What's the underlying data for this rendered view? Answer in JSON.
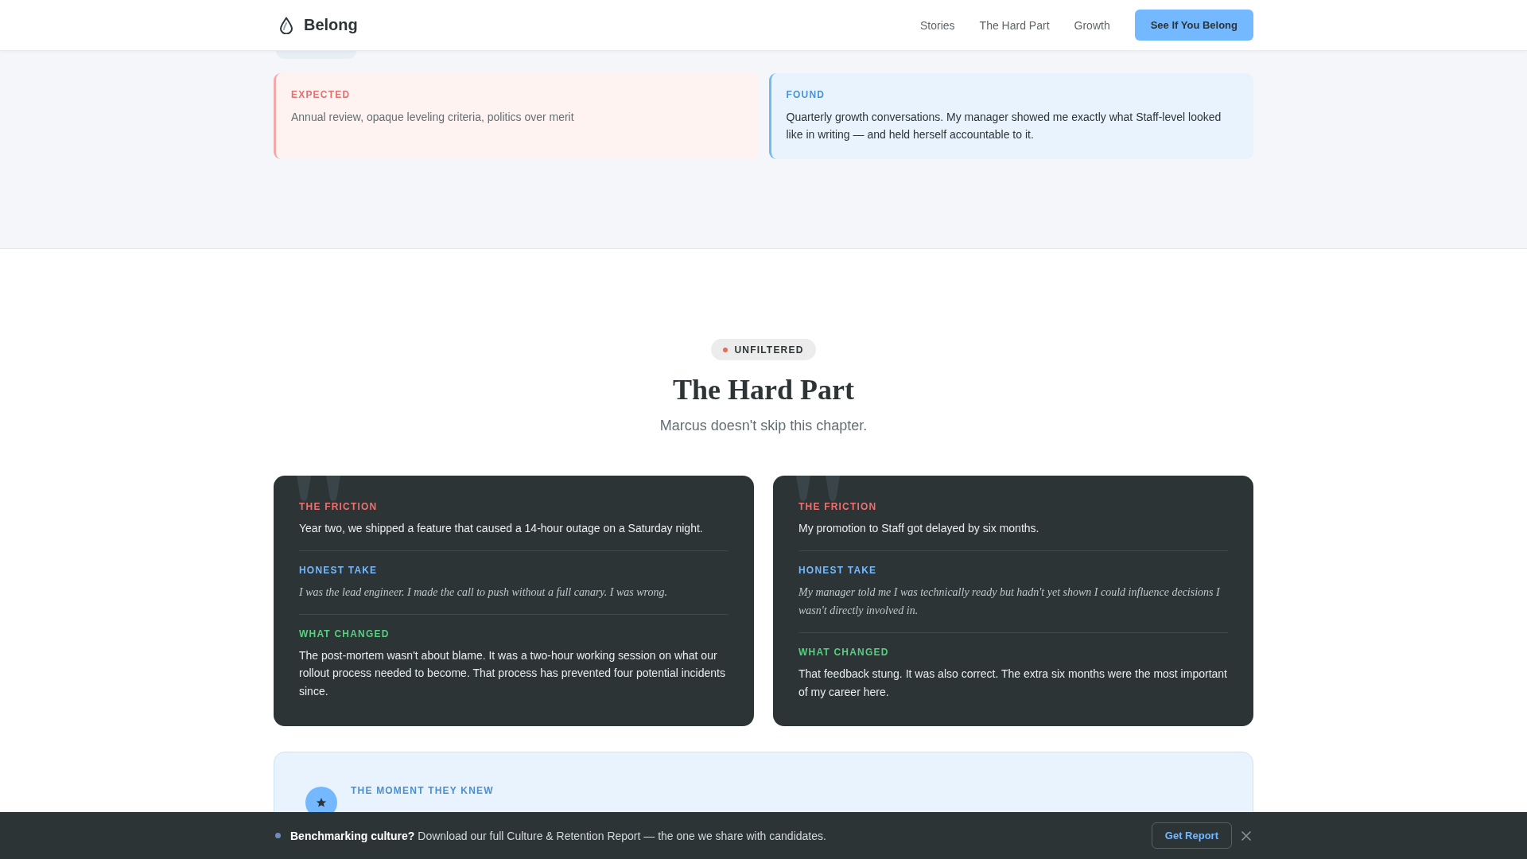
{
  "header": {
    "brand": "Belong",
    "nav": [
      "Stories",
      "The Hard Part",
      "Growth"
    ],
    "cta": "See If You Belong"
  },
  "growth_section": {
    "comparison": [
      {
        "kind": "expected",
        "label": "EXPECTED",
        "text": "Annual review, opaque leveling criteria, politics over merit"
      },
      {
        "kind": "found",
        "label": "FOUND",
        "text": "Quarterly growth conversations. My manager showed me exactly what Staff-level looked like in writing — and held herself accountable to it."
      }
    ]
  },
  "hard_part": {
    "badge": "UNFILTERED",
    "title": "The Hard Part",
    "subtitle": "Marcus doesn't skip this chapter.",
    "stories": [
      {
        "sections": [
          {
            "kind": "friction",
            "label": "THE FRICTION",
            "text": "Year two, we shipped a feature that caused a 14-hour outage on a Saturday night."
          },
          {
            "kind": "honest",
            "label": "HONEST TAKE",
            "text": "I was the lead engineer. I made the call to push without a full canary. I was wrong."
          },
          {
            "kind": "changed",
            "label": "WHAT CHANGED",
            "text": "The post-mortem wasn't about blame. It was a two-hour working session on what our rollout process needed to become. That process has prevented four potential incidents since."
          }
        ]
      },
      {
        "sections": [
          {
            "kind": "friction",
            "label": "THE FRICTION",
            "text": "My promotion to Staff got delayed by six months."
          },
          {
            "kind": "honest",
            "label": "HONEST TAKE",
            "text": "My manager told me I was technically ready but hadn't yet shown I could influence decisions I wasn't directly involved in."
          },
          {
            "kind": "changed",
            "label": "WHAT CHANGED",
            "text": "That feedback stung. It was also correct. The extra six months were the most important of my career here."
          }
        ]
      }
    ],
    "moment": {
      "label": "THE MOMENT THEY KNEW"
    }
  },
  "banner": {
    "message": "**Benchmarking culture?** Download our full Culture & Retention Report — the one we share with candidates.",
    "button": "Get Report"
  }
}
